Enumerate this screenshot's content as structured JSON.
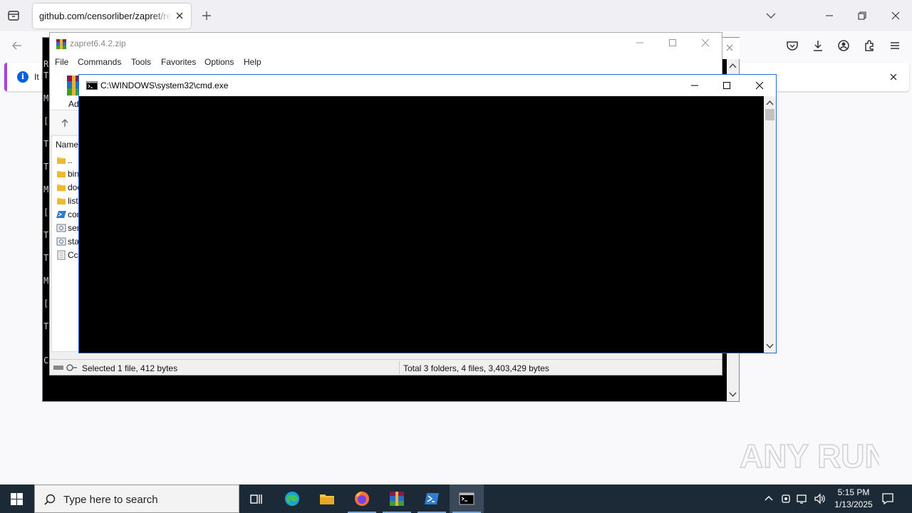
{
  "browser": {
    "tab_title": "github.com/censorliber/zapret/releases",
    "notice_text": "It l"
  },
  "winrar": {
    "title": "zapret6.4.2.zip",
    "menu": [
      "File",
      "Commands",
      "Tools",
      "Favorites",
      "Options",
      "Help"
    ],
    "toolbar_add_label": "Ad",
    "list_header": "Name",
    "files": [
      {
        "name": "..",
        "icon": "folder-icon"
      },
      {
        "name": "bin",
        "icon": "folder-icon"
      },
      {
        "name": "doc",
        "icon": "folder-icon"
      },
      {
        "name": "lists",
        "icon": "folder-icon"
      },
      {
        "name": "cor",
        "icon": "powershell-file-icon"
      },
      {
        "name": "serv",
        "icon": "batch-file-icon"
      },
      {
        "name": "star",
        "icon": "batch-file-icon"
      },
      {
        "name": "Ссь",
        "icon": "text-file-icon"
      }
    ],
    "status_left": "Selected 1 file, 412 bytes",
    "status_right": "Total 3 folders, 4 files, 3,403,429 bytes"
  },
  "background_console": {
    "side_chars": [
      "R",
      "T",
      "M",
      "[",
      "T",
      "T",
      "M",
      "[",
      "T",
      "T",
      "M",
      "[",
      "T",
      "C"
    ]
  },
  "cmd": {
    "title": "C:\\WINDOWS\\system32\\cmd.exe"
  },
  "taskbar": {
    "search_placeholder": "Type here to search",
    "time": "5:15 PM",
    "date": "1/13/2025"
  },
  "watermark": {
    "text": "ANY RUN"
  },
  "colors": {
    "taskbar_bg": "#1c2a38",
    "firefox_tabbar": "#f0f0f4",
    "notice_accent": "#a347d6",
    "cmd_bg": "#000000"
  }
}
